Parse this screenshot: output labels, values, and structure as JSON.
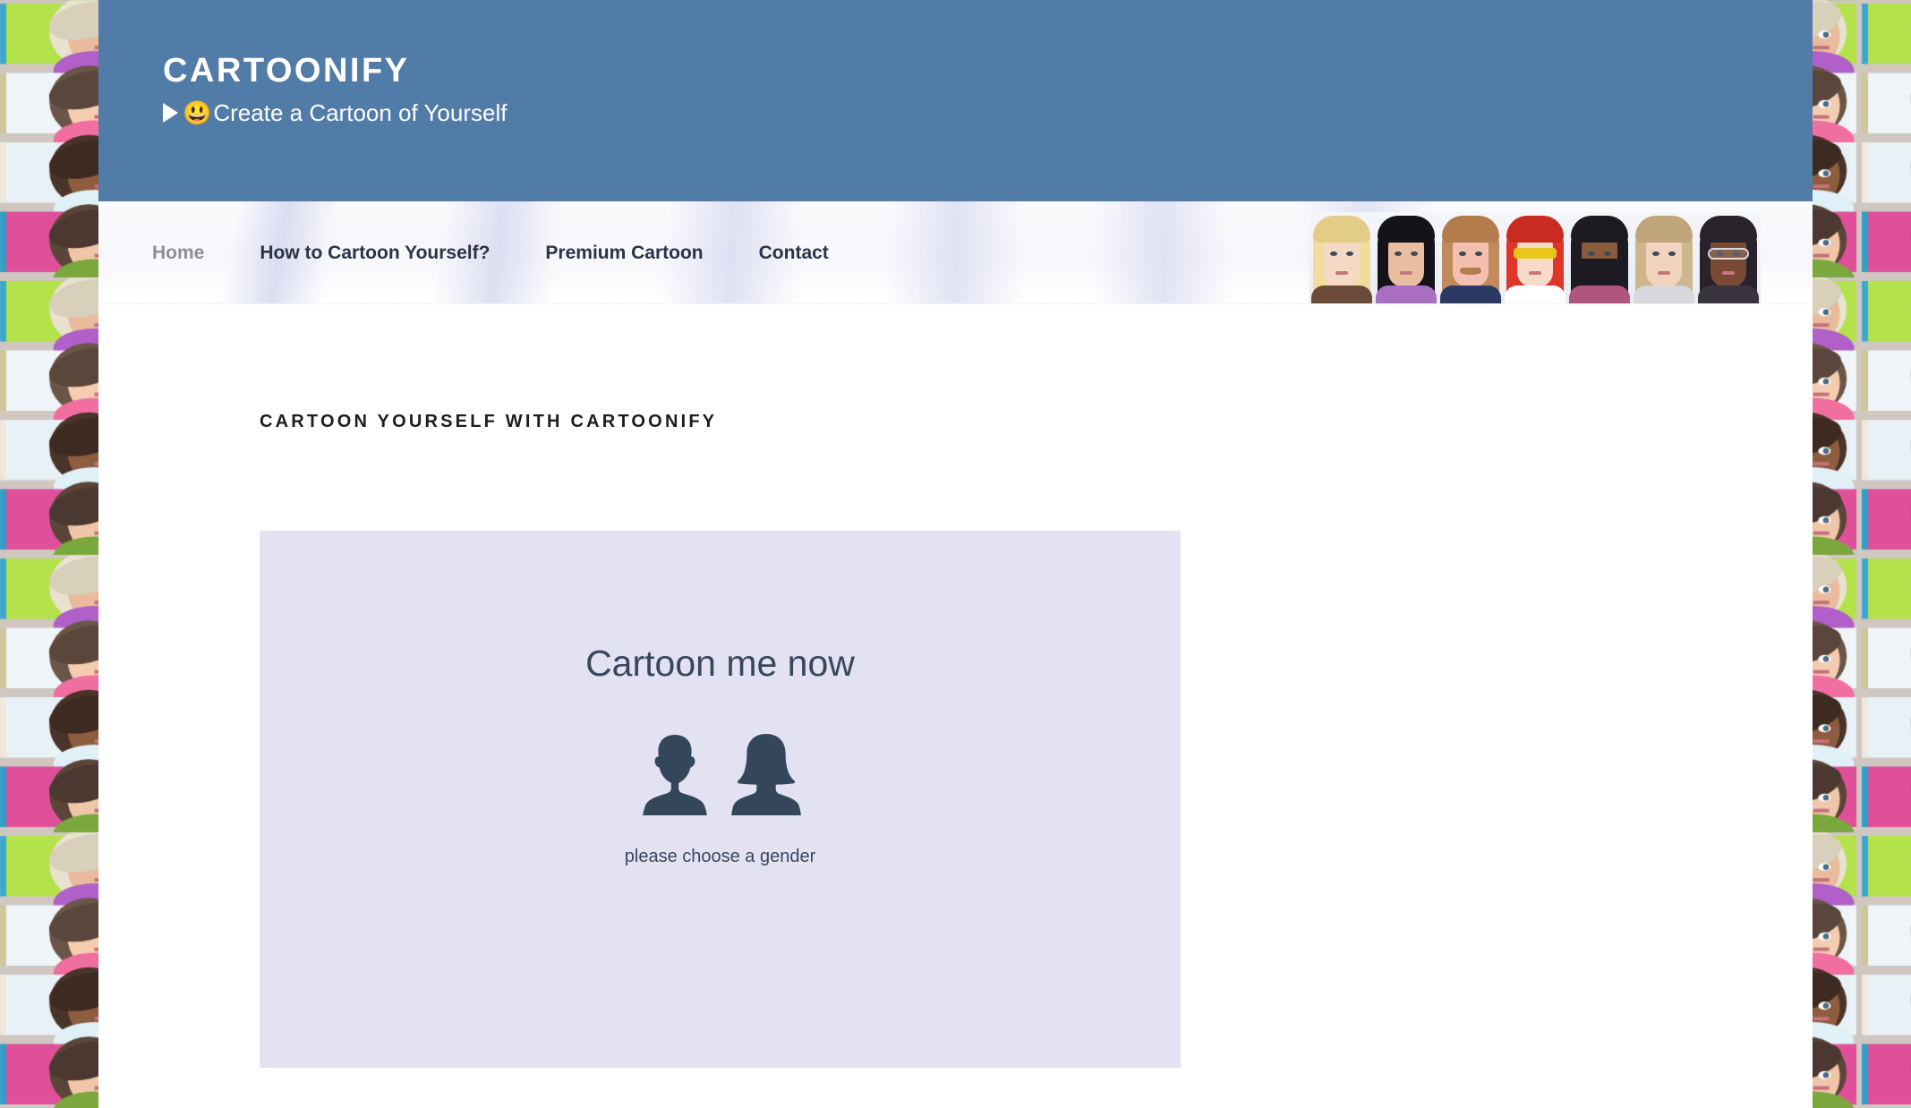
{
  "header": {
    "site_title": "CARTOONIFY",
    "tagline_icon": "play-triangle-icon",
    "tagline_emoji": "😃",
    "tagline": "Create a Cartoon of Yourself",
    "background_color": "#527ca8",
    "title_color": "#ffffff"
  },
  "nav": {
    "items": [
      {
        "label": "Home",
        "active": true
      },
      {
        "label": "How to Cartoon Yourself?",
        "active": false
      },
      {
        "label": "Premium Cartoon",
        "active": false
      },
      {
        "label": "Contact",
        "active": false
      }
    ],
    "active_color": "#8d8f96",
    "link_color": "#2b3347",
    "avatars": [
      {
        "name": "blonde-woman-avatar",
        "hair": "#f0dd9e",
        "hair2": "#e3cc86",
        "skin": "#f6d9c4",
        "body": "#6b4b3a",
        "feature": "none"
      },
      {
        "name": "black-hair-person-avatar",
        "hair": "#15131a",
        "hair2": "#15131a",
        "skin": "#e9bfa2",
        "body": "#a86fc0",
        "feature": "none"
      },
      {
        "name": "mustache-man-avatar",
        "hair": "#c08a5a",
        "hair2": "#b37c4c",
        "skin": "#f4bfae",
        "body": "#2b3a63",
        "feature": "mustache"
      },
      {
        "name": "red-hair-sunglasses-avatar",
        "hair": "#e0362a",
        "hair2": "#c92b20",
        "skin": "#f7dac9",
        "body": "#ffffff",
        "feature": "sunglasses"
      },
      {
        "name": "bearded-man-avatar",
        "hair": "#1d1a22",
        "hair2": "#1d1a22",
        "skin": "#8a5a3c",
        "body": "#b0557f",
        "feature": "beard"
      },
      {
        "name": "light-brown-hair-avatar",
        "hair": "#cdb68c",
        "hair2": "#bfa579",
        "skin": "#f2d3bd",
        "body": "#d8d8dc",
        "feature": "none"
      },
      {
        "name": "dark-skin-glasses-avatar",
        "hair": "#2a222b",
        "hair2": "#2a222b",
        "skin": "#7a4b34",
        "body": "#3a3440",
        "feature": "glasses"
      }
    ]
  },
  "main": {
    "page_heading": "CARTOON YOURSELF WITH CARTOONIFY",
    "widget": {
      "title": "Cartoon me now",
      "hint": "please choose a gender",
      "panel_color": "#e2e2f3",
      "text_color": "#39475c",
      "silhouette_color": "#34475a",
      "male_label": "male",
      "female_label": "female"
    }
  }
}
